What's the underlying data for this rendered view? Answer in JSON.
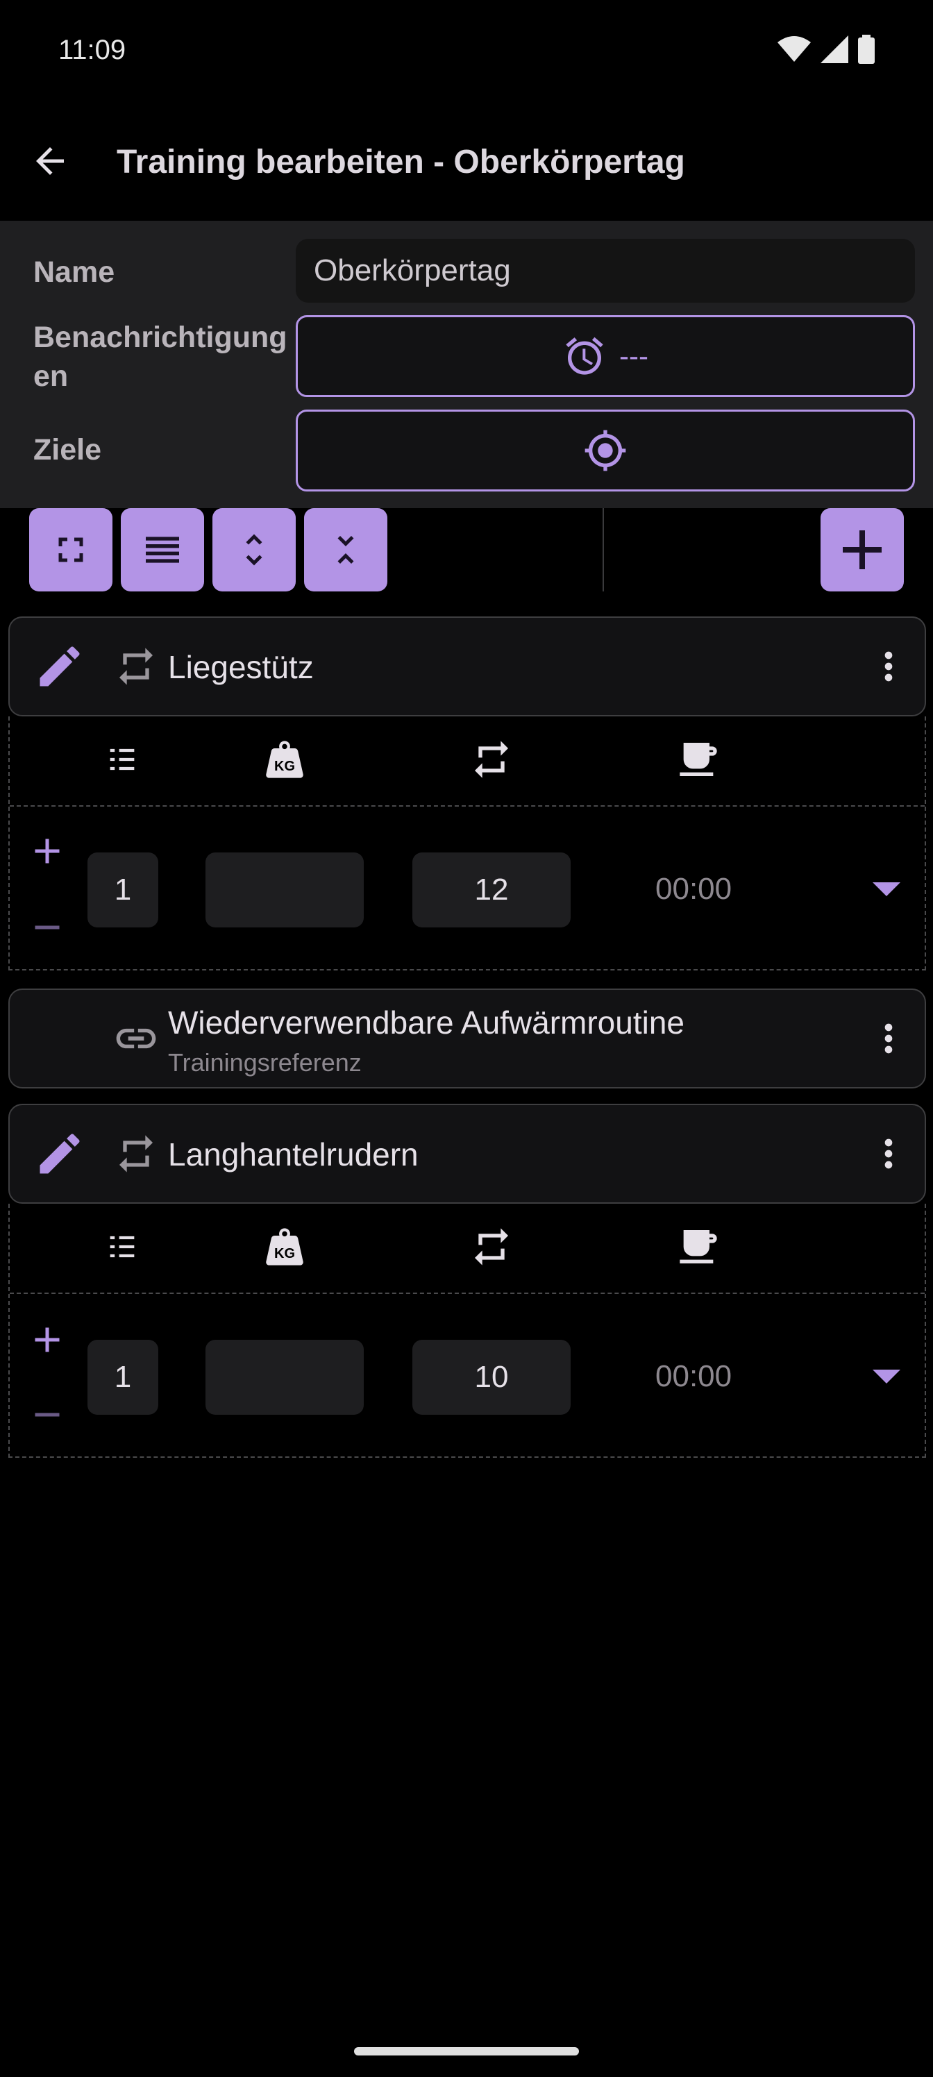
{
  "status": {
    "time": "11:09"
  },
  "appbar": {
    "title": "Training bearbeiten - Oberkörpertag"
  },
  "form": {
    "name_label": "Name",
    "name_value": "Oberkörpertag",
    "notifications_label": "Benachrichtigungen",
    "notifications_value": "---",
    "goals_label": "Ziele"
  },
  "exercises": [
    {
      "title": "Liegestütz",
      "set": {
        "number": "1",
        "weight": "",
        "reps": "12",
        "time": "00:00"
      }
    },
    {
      "title": "Wiederverwendbare Aufwärmroutine",
      "subtitle": "Trainingsreferenz"
    },
    {
      "title": "Langhantelrudern",
      "set": {
        "number": "1",
        "weight": "",
        "reps": "10",
        "time": "00:00"
      }
    }
  ],
  "colors": {
    "accent": "#b394e6",
    "background": "#000000",
    "surface": "#1f1f21",
    "card": "#121214"
  },
  "icons": [
    "back-arrow-icon",
    "alarm-icon",
    "target-icon",
    "fullscreen-icon",
    "list-icon",
    "expand-icon",
    "collapse-icon",
    "plus-icon",
    "edit-icon",
    "repeat-icon",
    "more-vert-icon",
    "link-icon",
    "numbered-list-icon",
    "kg-weight-icon",
    "coffee-icon",
    "dropdown-arrow-icon"
  ]
}
